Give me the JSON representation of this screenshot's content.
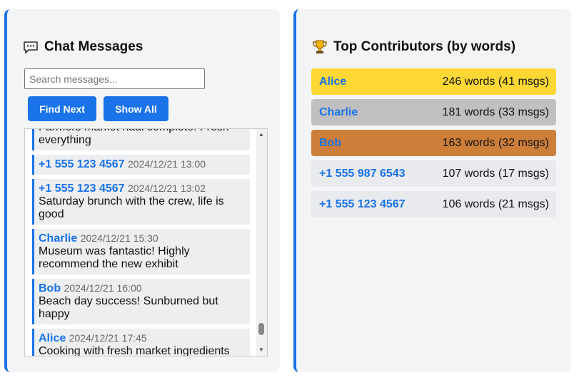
{
  "chat": {
    "title": "Chat Messages",
    "search_placeholder": "Search messages...",
    "find_next_label": "Find Next",
    "show_all_label": "Show All",
    "messages": [
      {
        "sender": "",
        "time": "",
        "text": "Farmers market haul complete! Fresh everything"
      },
      {
        "sender": "+1 555 123 4567",
        "time": "2024/12/21 13:00",
        "text": ""
      },
      {
        "sender": "+1 555 123 4567",
        "time": "2024/12/21 13:02",
        "text": "Saturday brunch with the crew, life is good"
      },
      {
        "sender": "Charlie",
        "time": "2024/12/21 15:30",
        "text": "Museum was fantastic! Highly recommend the new exhibit"
      },
      {
        "sender": "Bob",
        "time": "2024/12/21 16:00",
        "text": "Beach day success! Sunburned but happy"
      },
      {
        "sender": "Alice",
        "time": "2024/12/21 17:45",
        "text": "Cooking with fresh market ingredients tonight"
      }
    ]
  },
  "contributors": {
    "title": "Top Contributors (by words)",
    "items": [
      {
        "name": "Alice",
        "stat": "246 words (41 msgs)",
        "bg": "#fdd835"
      },
      {
        "name": "Charlie",
        "stat": "181 words (33 msgs)",
        "bg": "#c0c0c0"
      },
      {
        "name": "Bob",
        "stat": "163 words (32 msgs)",
        "bg": "#cd7f3a"
      },
      {
        "name": "+1 555 987 6543",
        "stat": "107 words (17 msgs)",
        "bg": "#e8eaed"
      },
      {
        "name": "+1 555 123 4567",
        "stat": "106 words (21 msgs)",
        "bg": "#e8eaed"
      }
    ]
  },
  "colors": {
    "accent": "#1a73e8",
    "panel_bg": "#f3f4f6"
  },
  "icons": {
    "chat": "speech-bubble-icon",
    "trophy": "trophy-icon"
  }
}
